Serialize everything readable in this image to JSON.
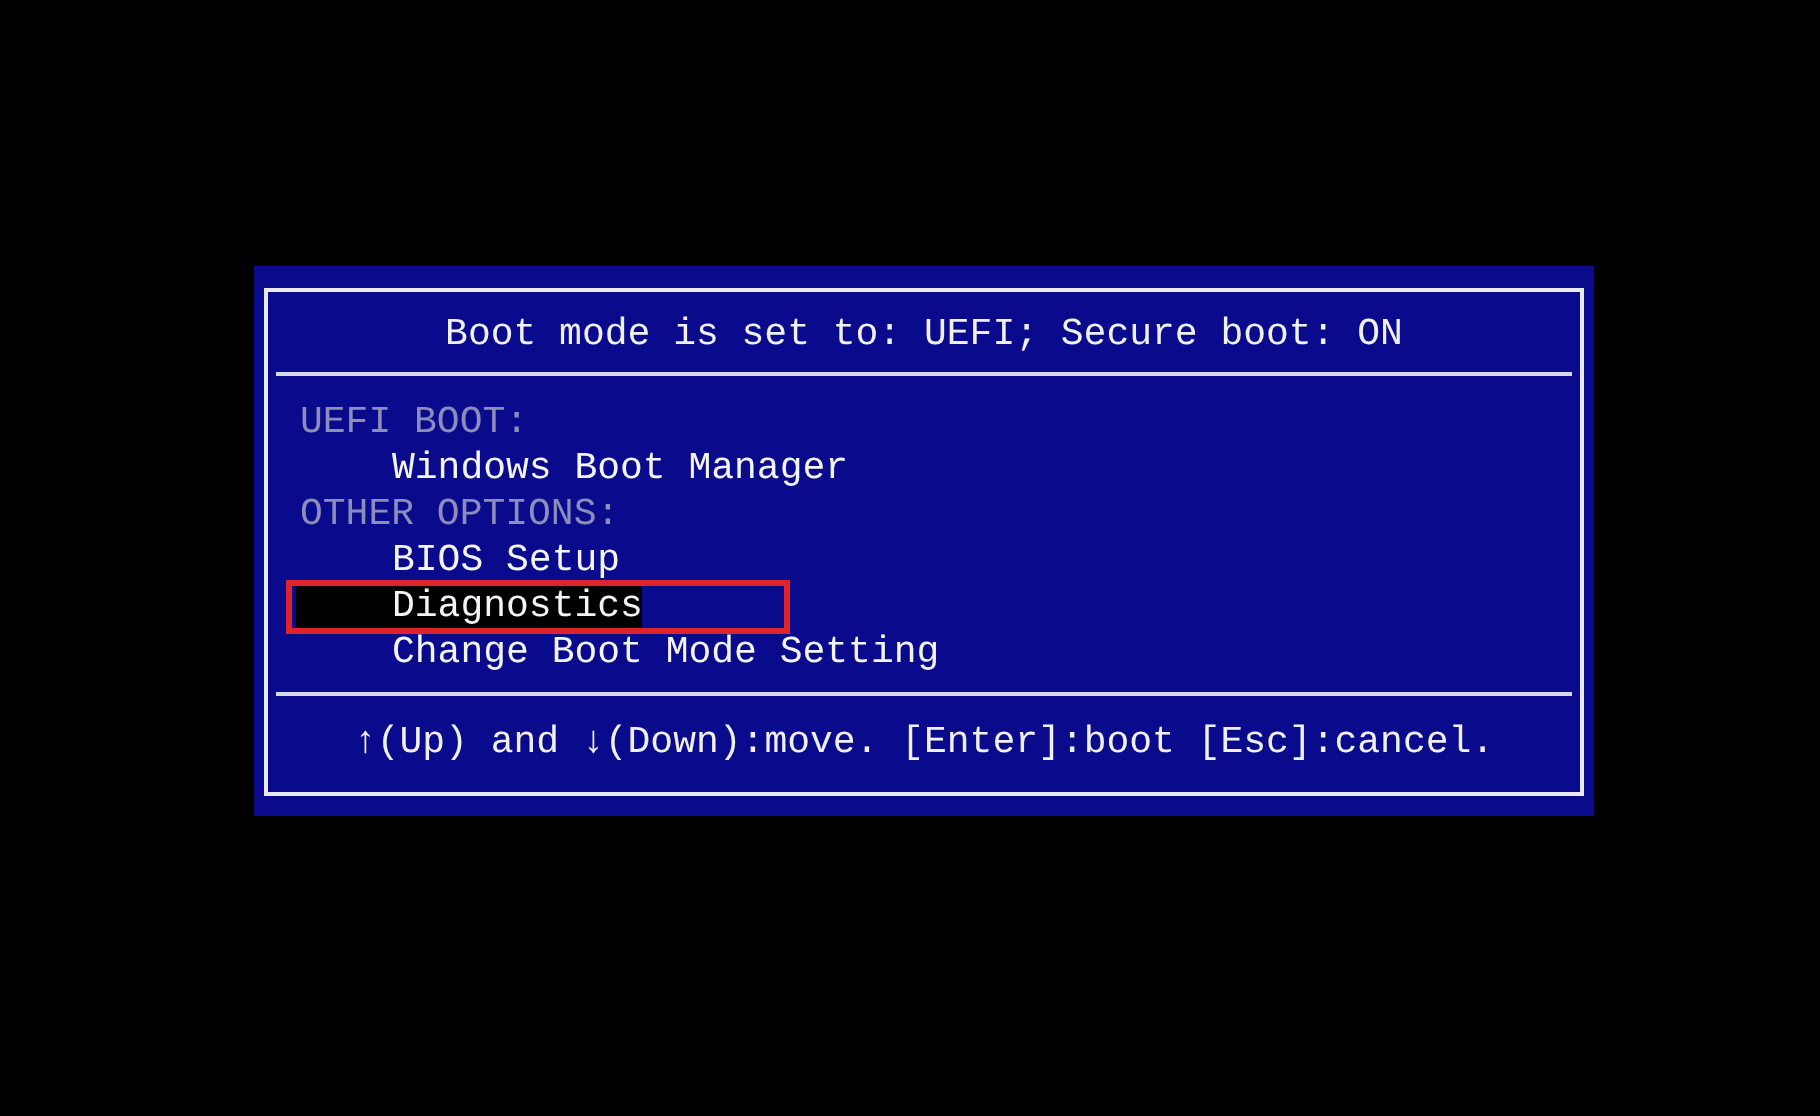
{
  "header": {
    "title": "Boot mode is set to: UEFI; Secure boot: ON"
  },
  "groups": [
    {
      "label": "UEFI BOOT:",
      "items": [
        {
          "label": "Windows Boot Manager",
          "selected": false
        }
      ]
    },
    {
      "label": "OTHER OPTIONS:",
      "items": [
        {
          "label": "BIOS Setup",
          "selected": false
        },
        {
          "label": "Diagnostics",
          "selected": true
        },
        {
          "label": "Change Boot Mode Setting",
          "selected": false
        }
      ]
    }
  ],
  "footer": {
    "up_arrow": "↑",
    "up_text": "(Up) and ",
    "down_arrow": "↓",
    "down_text": "(Down):move. [Enter]:boot [Esc]:cancel."
  }
}
